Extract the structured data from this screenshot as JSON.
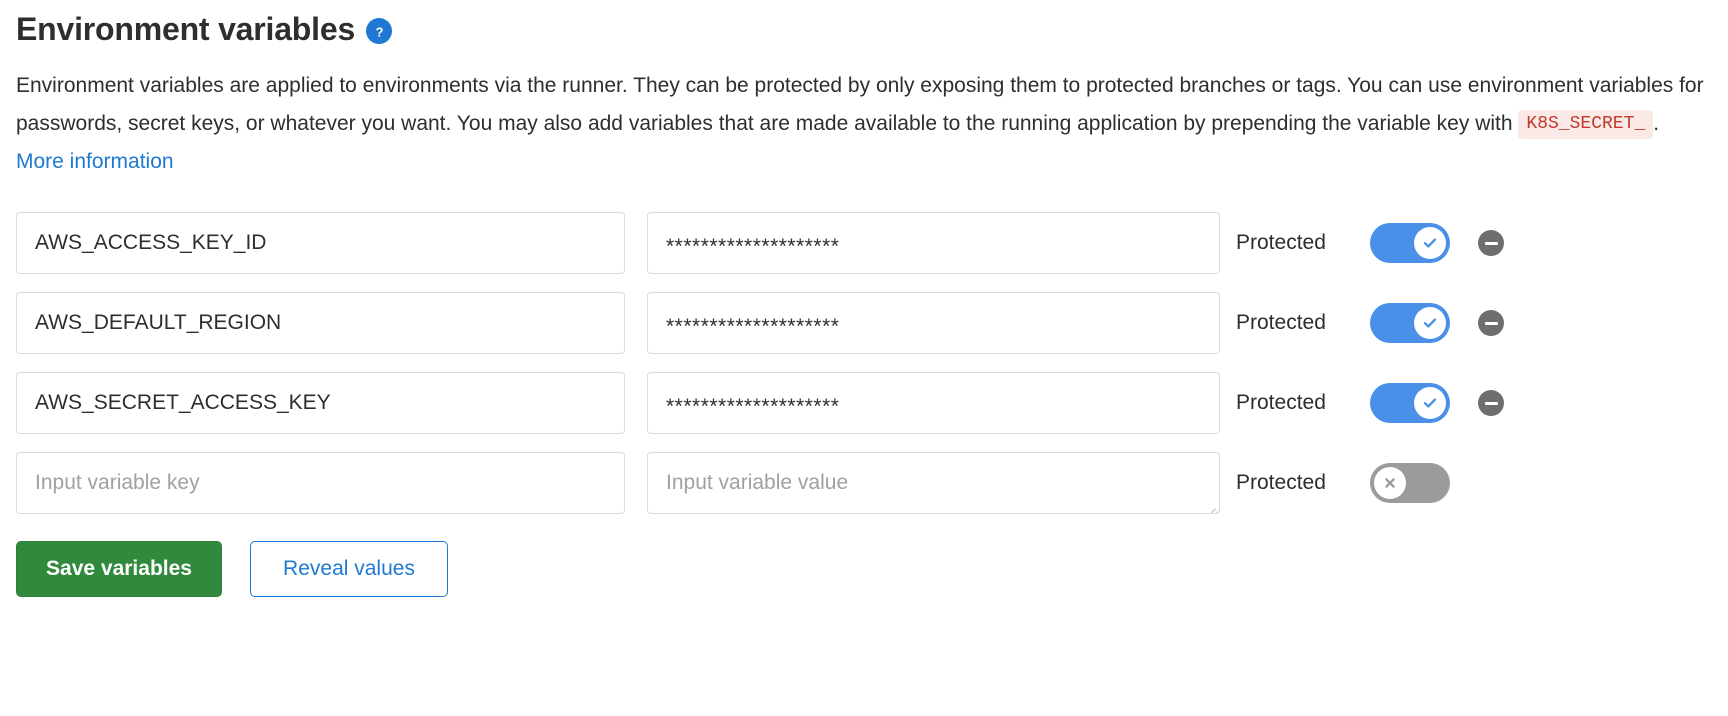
{
  "header": {
    "title": "Environment variables",
    "help_icon": "question-circle-icon"
  },
  "description": {
    "part1": "Environment variables are applied to environments via the runner. They can be protected by only exposing them to protected branches or tags. You can use environment variables for passwords, secret keys, or whatever you want. You may also add variables that are made available to the running application by prepending the variable key with",
    "code": "K8S_SECRET_",
    "part2": ".",
    "link": "More information"
  },
  "table": {
    "protected_label": "Protected",
    "key_placeholder": "Input variable key",
    "value_placeholder": "Input variable value",
    "rows": [
      {
        "key": "AWS_ACCESS_KEY_ID",
        "value": "********************",
        "protected_label": "Protected",
        "protected": "on",
        "toggle_state_icon": "check-icon",
        "remove_icon": "minus-circle-icon",
        "removable": "yes"
      },
      {
        "key": "AWS_DEFAULT_REGION",
        "value": "********************",
        "protected_label": "Protected",
        "protected": "on",
        "toggle_state_icon": "check-icon",
        "remove_icon": "minus-circle-icon",
        "removable": "yes"
      },
      {
        "key": "AWS_SECRET_ACCESS_KEY",
        "value": "********************",
        "protected_label": "Protected",
        "protected": "on",
        "toggle_state_icon": "check-icon",
        "remove_icon": "minus-circle-icon",
        "removable": "yes"
      },
      {
        "key": "",
        "value": "",
        "protected_label": "Protected",
        "protected": "off",
        "toggle_state_icon": "close-icon",
        "remove_icon": "",
        "removable": "no"
      }
    ]
  },
  "actions": {
    "save_label": "Save variables",
    "reveal_label": "Reveal values"
  },
  "colors": {
    "accent_blue": "#1f78d1",
    "toggle_on": "#4a8fe8",
    "toggle_off": "#9b9b9b",
    "save_green": "#31893e",
    "code_text": "#c0392b",
    "code_background": "#fbe9e7",
    "remove_gray": "#6e6e6e",
    "border": "#dbdbdb",
    "text": "#2e2e2e",
    "placeholder": "#a0a0a0"
  }
}
